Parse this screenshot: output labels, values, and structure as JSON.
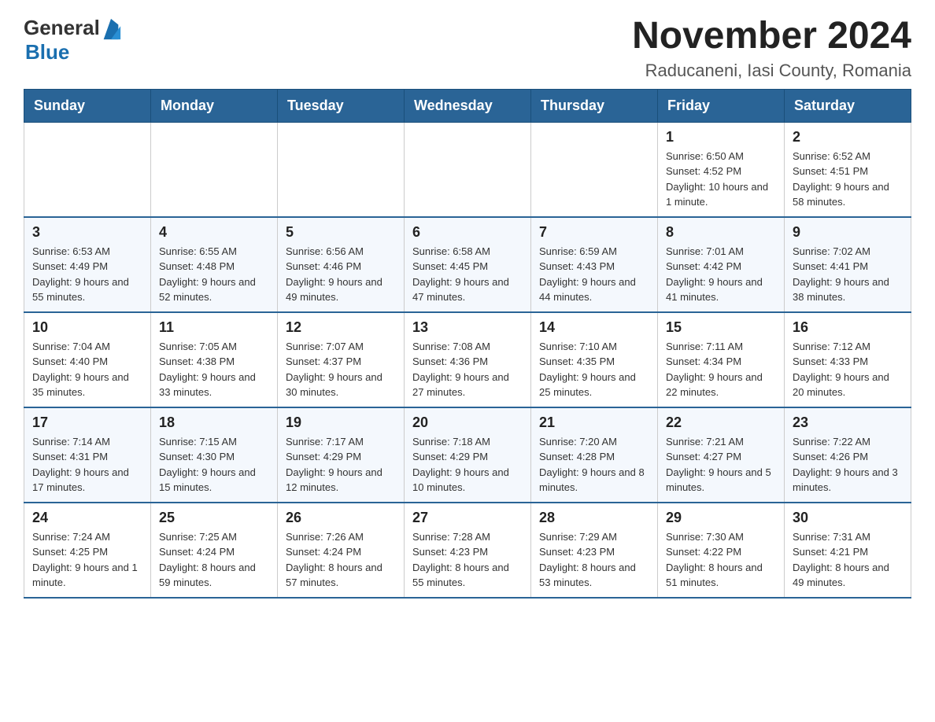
{
  "header": {
    "logo_general": "General",
    "logo_blue": "Blue",
    "title": "November 2024",
    "subtitle": "Raducaneni, Iasi County, Romania"
  },
  "days_of_week": [
    "Sunday",
    "Monday",
    "Tuesday",
    "Wednesday",
    "Thursday",
    "Friday",
    "Saturday"
  ],
  "weeks": [
    [
      {
        "day": "",
        "info": ""
      },
      {
        "day": "",
        "info": ""
      },
      {
        "day": "",
        "info": ""
      },
      {
        "day": "",
        "info": ""
      },
      {
        "day": "",
        "info": ""
      },
      {
        "day": "1",
        "info": "Sunrise: 6:50 AM\nSunset: 4:52 PM\nDaylight: 10 hours and 1 minute."
      },
      {
        "day": "2",
        "info": "Sunrise: 6:52 AM\nSunset: 4:51 PM\nDaylight: 9 hours and 58 minutes."
      }
    ],
    [
      {
        "day": "3",
        "info": "Sunrise: 6:53 AM\nSunset: 4:49 PM\nDaylight: 9 hours and 55 minutes."
      },
      {
        "day": "4",
        "info": "Sunrise: 6:55 AM\nSunset: 4:48 PM\nDaylight: 9 hours and 52 minutes."
      },
      {
        "day": "5",
        "info": "Sunrise: 6:56 AM\nSunset: 4:46 PM\nDaylight: 9 hours and 49 minutes."
      },
      {
        "day": "6",
        "info": "Sunrise: 6:58 AM\nSunset: 4:45 PM\nDaylight: 9 hours and 47 minutes."
      },
      {
        "day": "7",
        "info": "Sunrise: 6:59 AM\nSunset: 4:43 PM\nDaylight: 9 hours and 44 minutes."
      },
      {
        "day": "8",
        "info": "Sunrise: 7:01 AM\nSunset: 4:42 PM\nDaylight: 9 hours and 41 minutes."
      },
      {
        "day": "9",
        "info": "Sunrise: 7:02 AM\nSunset: 4:41 PM\nDaylight: 9 hours and 38 minutes."
      }
    ],
    [
      {
        "day": "10",
        "info": "Sunrise: 7:04 AM\nSunset: 4:40 PM\nDaylight: 9 hours and 35 minutes."
      },
      {
        "day": "11",
        "info": "Sunrise: 7:05 AM\nSunset: 4:38 PM\nDaylight: 9 hours and 33 minutes."
      },
      {
        "day": "12",
        "info": "Sunrise: 7:07 AM\nSunset: 4:37 PM\nDaylight: 9 hours and 30 minutes."
      },
      {
        "day": "13",
        "info": "Sunrise: 7:08 AM\nSunset: 4:36 PM\nDaylight: 9 hours and 27 minutes."
      },
      {
        "day": "14",
        "info": "Sunrise: 7:10 AM\nSunset: 4:35 PM\nDaylight: 9 hours and 25 minutes."
      },
      {
        "day": "15",
        "info": "Sunrise: 7:11 AM\nSunset: 4:34 PM\nDaylight: 9 hours and 22 minutes."
      },
      {
        "day": "16",
        "info": "Sunrise: 7:12 AM\nSunset: 4:33 PM\nDaylight: 9 hours and 20 minutes."
      }
    ],
    [
      {
        "day": "17",
        "info": "Sunrise: 7:14 AM\nSunset: 4:31 PM\nDaylight: 9 hours and 17 minutes."
      },
      {
        "day": "18",
        "info": "Sunrise: 7:15 AM\nSunset: 4:30 PM\nDaylight: 9 hours and 15 minutes."
      },
      {
        "day": "19",
        "info": "Sunrise: 7:17 AM\nSunset: 4:29 PM\nDaylight: 9 hours and 12 minutes."
      },
      {
        "day": "20",
        "info": "Sunrise: 7:18 AM\nSunset: 4:29 PM\nDaylight: 9 hours and 10 minutes."
      },
      {
        "day": "21",
        "info": "Sunrise: 7:20 AM\nSunset: 4:28 PM\nDaylight: 9 hours and 8 minutes."
      },
      {
        "day": "22",
        "info": "Sunrise: 7:21 AM\nSunset: 4:27 PM\nDaylight: 9 hours and 5 minutes."
      },
      {
        "day": "23",
        "info": "Sunrise: 7:22 AM\nSunset: 4:26 PM\nDaylight: 9 hours and 3 minutes."
      }
    ],
    [
      {
        "day": "24",
        "info": "Sunrise: 7:24 AM\nSunset: 4:25 PM\nDaylight: 9 hours and 1 minute."
      },
      {
        "day": "25",
        "info": "Sunrise: 7:25 AM\nSunset: 4:24 PM\nDaylight: 8 hours and 59 minutes."
      },
      {
        "day": "26",
        "info": "Sunrise: 7:26 AM\nSunset: 4:24 PM\nDaylight: 8 hours and 57 minutes."
      },
      {
        "day": "27",
        "info": "Sunrise: 7:28 AM\nSunset: 4:23 PM\nDaylight: 8 hours and 55 minutes."
      },
      {
        "day": "28",
        "info": "Sunrise: 7:29 AM\nSunset: 4:23 PM\nDaylight: 8 hours and 53 minutes."
      },
      {
        "day": "29",
        "info": "Sunrise: 7:30 AM\nSunset: 4:22 PM\nDaylight: 8 hours and 51 minutes."
      },
      {
        "day": "30",
        "info": "Sunrise: 7:31 AM\nSunset: 4:21 PM\nDaylight: 8 hours and 49 minutes."
      }
    ]
  ]
}
